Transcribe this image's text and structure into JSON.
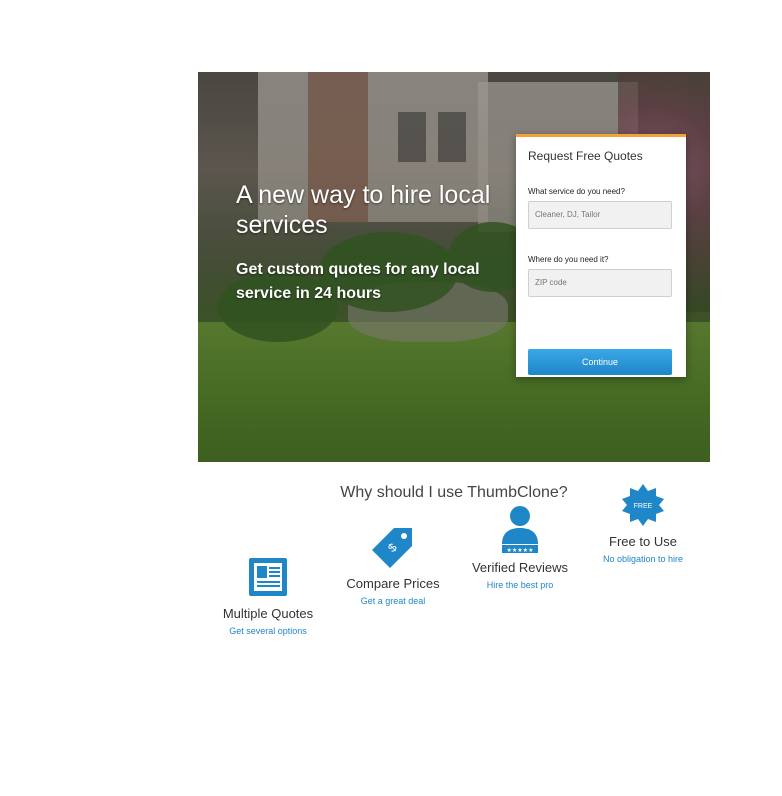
{
  "hero": {
    "title": "A new way to hire local services",
    "subtitle": "Get custom quotes for any local service in 24 hours"
  },
  "form": {
    "title": "Request Free Quotes",
    "service_label": "What service do you need?",
    "service_placeholder": "Cleaner, DJ, Tailor",
    "location_label": "Where do you need it?",
    "location_placeholder": "ZIP code",
    "continue_label": "Continue"
  },
  "features": {
    "heading": "Why should I use ThumbClone?",
    "items": [
      {
        "icon": "quotes-document-icon",
        "title": "Multiple Quotes",
        "subtitle": "Get several options"
      },
      {
        "icon": "price-tag-icon",
        "title": "Compare Prices",
        "subtitle": "Get a great deal"
      },
      {
        "icon": "verified-user-icon",
        "title": "Verified Reviews",
        "subtitle": "Hire the best pro"
      },
      {
        "icon": "free-badge-icon",
        "title": "Free to Use",
        "subtitle": "No obligation to hire",
        "badge_text": "FREE"
      }
    ]
  },
  "colors": {
    "accent": "#1f86c8",
    "form_border": "#f2a23a"
  }
}
